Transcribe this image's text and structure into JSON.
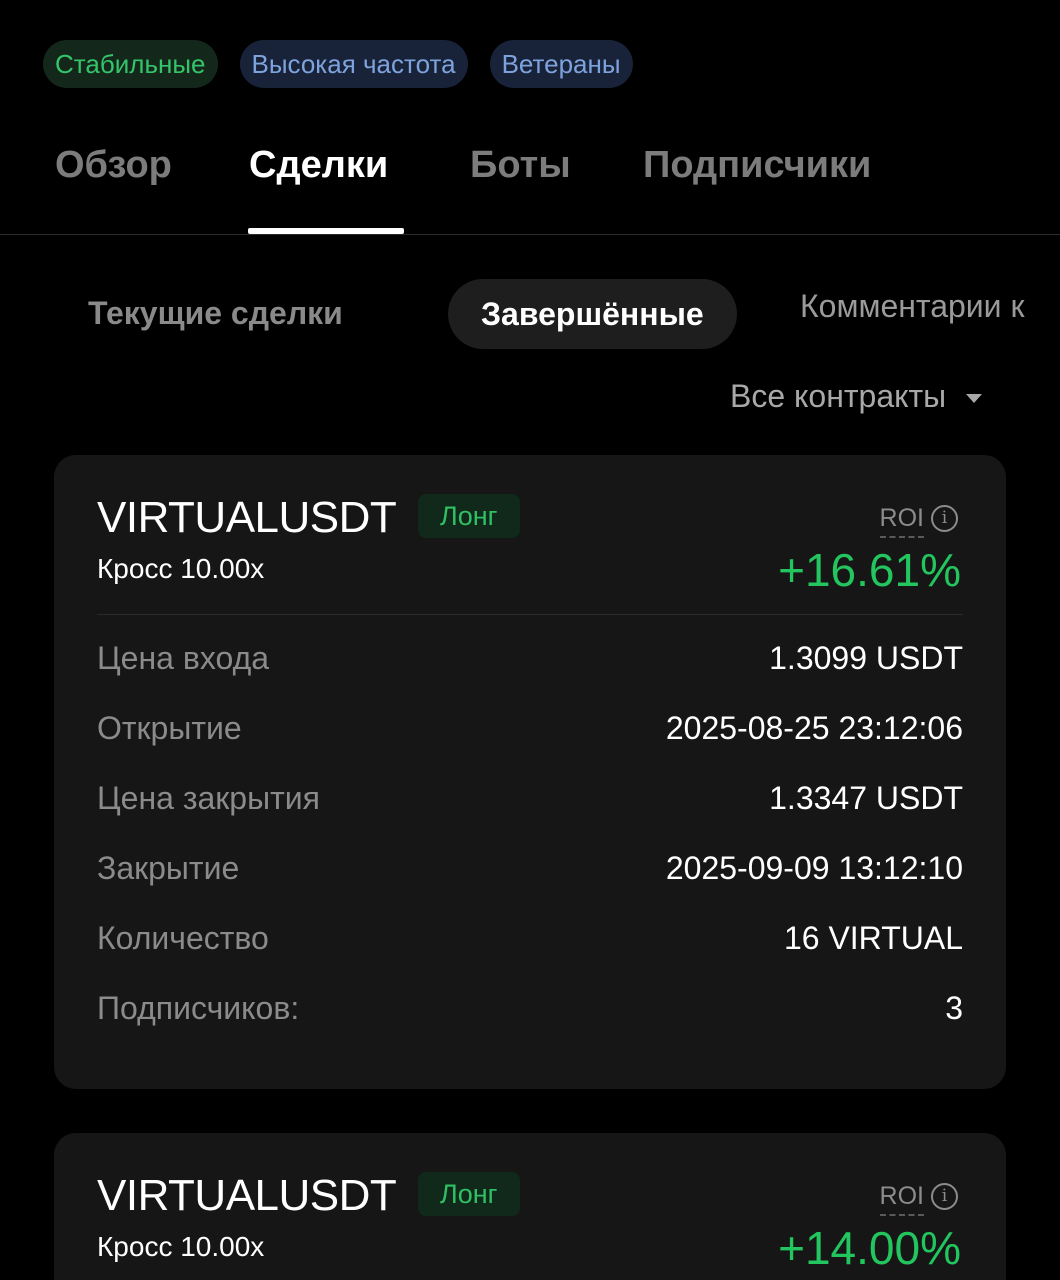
{
  "tags": [
    "Стабильные",
    "Высокая частота",
    "Ветераны"
  ],
  "colors": {
    "green": "#22c55e",
    "blue_tag": "#7ea3dc",
    "background": "#000000",
    "card": "#161616"
  },
  "main_tabs": [
    "Обзор",
    "Сделки",
    "Боты",
    "Подписчики"
  ],
  "main_tab_active": "Сделки",
  "sub_tabs": [
    "Текущие сделки",
    "Завершённые",
    "Комментарии к"
  ],
  "sub_tab_active": "Завершённые",
  "filter": {
    "label": "Все контракты",
    "icon": "caret-down-icon"
  },
  "cards": [
    {
      "symbol": "VIRTUALUSDT",
      "side": "Лонг",
      "margin": "Кросс 10.00x",
      "roi_label": "ROI",
      "roi_value": "+16.61%",
      "rows": [
        {
          "label": "Цена входа",
          "value": "1.3099 USDT"
        },
        {
          "label": "Открытие",
          "value": "2025-08-25 23:12:06"
        },
        {
          "label": "Цена закрытия",
          "value": "1.3347 USDT"
        },
        {
          "label": "Закрытие",
          "value": "2025-09-09 13:12:10"
        },
        {
          "label": "Количество",
          "value": "16 VIRTUAL"
        },
        {
          "label": "Подписчиков:",
          "value": "3"
        }
      ]
    },
    {
      "symbol": "VIRTUALUSDT",
      "side": "Лонг",
      "margin": "Кросс 10.00x",
      "roi_label": "ROI",
      "roi_value": "+14.00%"
    }
  ]
}
